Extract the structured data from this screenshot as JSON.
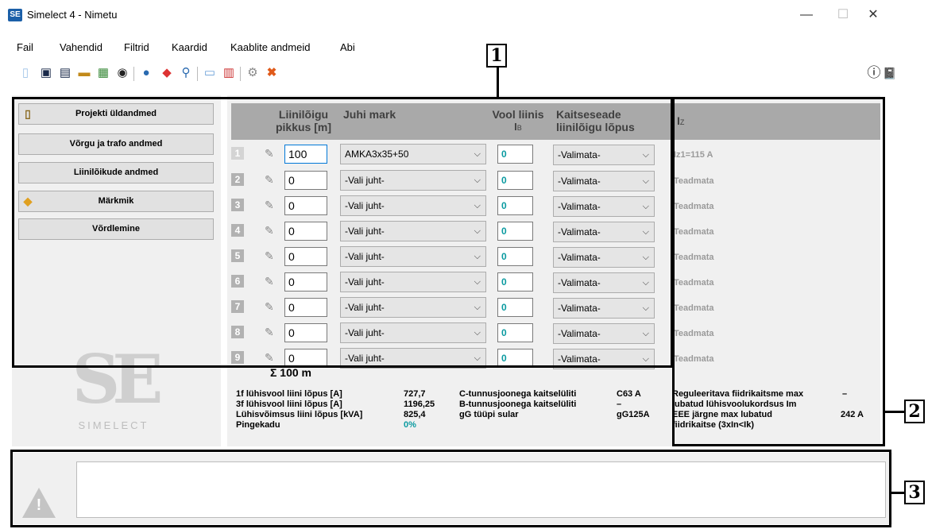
{
  "window": {
    "title": "Simelect 4 - Nimetu",
    "app_icon": "SE",
    "minimize": "—",
    "maximize": "☐",
    "close": "✕"
  },
  "menu": [
    {
      "label": "Fail"
    },
    {
      "label": "Vahendid"
    },
    {
      "label": "Filtrid"
    },
    {
      "label": "Kaardid"
    },
    {
      "label": "Kaablite andmeid"
    },
    {
      "label": "Abi"
    }
  ],
  "toolbar": {
    "icons": [
      "new-file-icon",
      "save-icon",
      "save-as-icon",
      "open-folder-icon",
      "print-icon",
      "camera-icon",
      "globe-icon",
      "map-pin-icon",
      "zoom-icon",
      "chart-icon",
      "table-icon",
      "settings-icon",
      "delete-icon"
    ],
    "info_glyph": "ⓘ",
    "book_glyph": "📓"
  },
  "nav": [
    {
      "label": "Projekti üldandmed"
    },
    {
      "label": "Võrgu ja trafo andmed"
    },
    {
      "label": "Liinilõikude andmed"
    },
    {
      "label": "Märkmik"
    },
    {
      "label": "Võrdlemine"
    }
  ],
  "logo": {
    "mark": "SE",
    "text": "SIMELECT"
  },
  "grid": {
    "headers": {
      "length_1": "Liinilõigu",
      "length_2": "pikkus [m]",
      "brand": "Juhi mark",
      "current_1": "Vool liinis",
      "current_2": "I",
      "current_sub": "B",
      "protect_1": "Kaitseseade",
      "protect_2": "liinilõigu lõpus",
      "iz": "I",
      "iz_sub": "Z"
    },
    "rows": [
      {
        "num": "1",
        "length": "100",
        "brand": "AMKA3x35+50",
        "current": "0",
        "protection": "-Valimata-",
        "iz": "Iz1=115 A"
      },
      {
        "num": "2",
        "length": "0",
        "brand": "-Vali juht-",
        "current": "0",
        "protection": "-Valimata-",
        "iz": "Teadmata"
      },
      {
        "num": "3",
        "length": "0",
        "brand": "-Vali juht-",
        "current": "0",
        "protection": "-Valimata-",
        "iz": "Teadmata"
      },
      {
        "num": "4",
        "length": "0",
        "brand": "-Vali juht-",
        "current": "0",
        "protection": "-Valimata-",
        "iz": "Teadmata"
      },
      {
        "num": "5",
        "length": "0",
        "brand": "-Vali juht-",
        "current": "0",
        "protection": "-Valimata-",
        "iz": "Teadmata"
      },
      {
        "num": "6",
        "length": "0",
        "brand": "-Vali juht-",
        "current": "0",
        "protection": "-Valimata-",
        "iz": "Teadmata"
      },
      {
        "num": "7",
        "length": "0",
        "brand": "-Vali juht-",
        "current": "0",
        "protection": "-Valimata-",
        "iz": "Teadmata"
      },
      {
        "num": "8",
        "length": "0",
        "brand": "-Vali juht-",
        "current": "0",
        "protection": "-Valimata-",
        "iz": "Teadmata"
      },
      {
        "num": "9",
        "length": "0",
        "brand": "-Vali juht-",
        "current": "0",
        "protection": "-Valimata-",
        "iz": "Teadmata"
      }
    ],
    "dropdown_glyph": "⌵",
    "sum": "Σ  100 m"
  },
  "stats": {
    "col1_labels": [
      "1f lühisvool liini lõpus [A]",
      "3f lühisvool liini lõpus [A]",
      "Lühisvõimsus liini lõpus [kVA]",
      "Pingekadu"
    ],
    "col1_values": [
      "727,7",
      "1196,25",
      "825,4",
      "0%"
    ],
    "col2_labels": [
      "C-tunnusjoonega kaitselüliti",
      "B-tunnusjoonega kaitselüliti",
      "gG tüüpi sular"
    ],
    "col2_values": [
      "C63 A",
      "–",
      "gG125A"
    ],
    "col3_line1": "Reguleeritava fiidrikaitsme max",
    "col3_line2": "lubatud lühisvoolukordsus Im",
    "col3_value1": "–",
    "col3_line3": "EEE järgne max lubatud",
    "col3_line4": "fiidrikaitse (3xIn<Ik)",
    "col3_value2": "242 A",
    "pingekadu_color": "#0a9aa0"
  },
  "message": {
    "text": "",
    "warn_glyph": "!"
  },
  "callouts": [
    "1",
    "2",
    "3"
  ]
}
